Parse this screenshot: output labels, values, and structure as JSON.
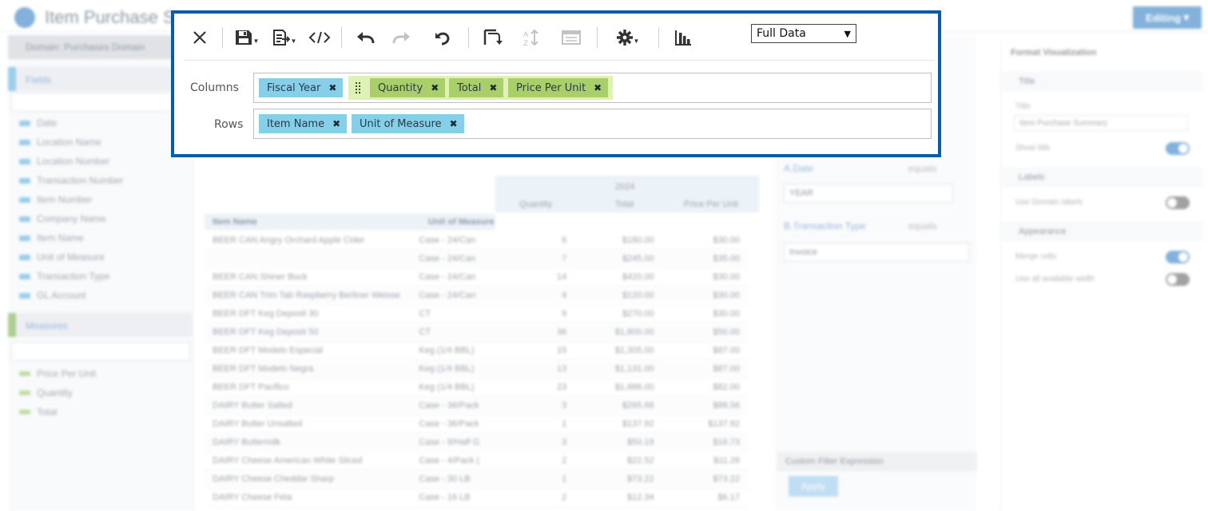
{
  "app": {
    "title": "Item Purchase Su",
    "edit_button": "Editing"
  },
  "left_panel": {
    "domain": "Domain: Purchases Domain",
    "fields_header": "Fields",
    "fields": [
      "Date",
      "Location Name",
      "Location Number",
      "Transaction Number",
      "Item Number",
      "Company Name",
      "Item Name",
      "Unit of Measure",
      "Transaction Type",
      "GL Account"
    ],
    "measures_header": "Measures",
    "measures": [
      "Price Per Unit",
      "Quantity",
      "Total"
    ]
  },
  "grid": {
    "year": "2024",
    "measure_headers": [
      "Quantity",
      "Total",
      "Price Per Unit"
    ],
    "row_headers": [
      "Item Name",
      "Unit of Measure"
    ],
    "rows": [
      [
        "BEER CAN Angry Orchard Apple Cider",
        "Case - 24/Can",
        "6",
        "$180.00",
        "$30.00"
      ],
      [
        "",
        "Case - 24/Can",
        "7",
        "$245.00",
        "$35.00"
      ],
      [
        "BEER CAN Shiner Bock",
        "Case - 24/Can",
        "14",
        "$420.00",
        "$30.00"
      ],
      [
        "BEER CAN Trim Tab Raspberry Berliner Weisse",
        "Case - 24/Can",
        "4",
        "$120.00",
        "$30.00"
      ],
      [
        "BEER DFT Keg Deposit 30",
        "CT",
        "9",
        "$270.00",
        "$30.00"
      ],
      [
        "BEER DFT Keg Deposit 50",
        "CT",
        "36",
        "$1,800.00",
        "$50.00"
      ],
      [
        "BEER DFT Modelo Especial",
        "Keg (1/4 BBL)",
        "15",
        "$1,305.00",
        "$87.00"
      ],
      [
        "BEER DFT Modelo Negra",
        "Keg (1/4 BBL)",
        "13",
        "$1,131.00",
        "$87.00"
      ],
      [
        "BEER DFT Pacifico",
        "Keg (1/4 BBL)",
        "23",
        "$1,886.00",
        "$82.00"
      ],
      [
        "DAIRY Butter Salted",
        "Case - 36/Pack",
        "3",
        "$265.68",
        "$88.56"
      ],
      [
        "DAIRY Butter Unsalted",
        "Case - 36/Pack",
        "1",
        "$137.92",
        "$137.92"
      ],
      [
        "DAIRY Buttermilk",
        "Case - 9/Half G",
        "3",
        "$50.19",
        "$16.73"
      ],
      [
        "DAIRY Cheese American White Sliced",
        "Case - 4/Pack (",
        "2",
        "$22.52",
        "$11.26"
      ],
      [
        "DAIRY Cheese Cheddar Sharp",
        "Case - 30 LB",
        "1",
        "$73.22",
        "$73.22"
      ],
      [
        "DAIRY Cheese Feta",
        "Case - 16 LB",
        "2",
        "$12.34",
        "$6.17"
      ]
    ]
  },
  "filters": {
    "filter_a": "A.Date",
    "filter_a_op": "equals",
    "filter_a_value": "YEAR",
    "filter_b": "B.Transaction Type",
    "filter_b_op": "equals",
    "filter_b_value": "Invoice",
    "custom_expression": "Custom Filter Expression",
    "apply": "Apply"
  },
  "format_panel": {
    "title": "Format Visualization",
    "title_section": "Title",
    "title_label": "Title",
    "title_value": "Item Purchase Summary",
    "show_title": "Show title",
    "labels_section": "Labels",
    "domain_labels": "Use Domain labels",
    "appearance_section": "Appearance",
    "merge_cells": "Merge cells",
    "available_width": "Use all available width"
  },
  "toolbar": {
    "view_mode": "Full Data",
    "view_options": [
      "Full Data"
    ]
  },
  "columns_shelf": {
    "label": "Columns",
    "fields": [
      "Fiscal Year"
    ],
    "measures": [
      "Quantity",
      "Total",
      "Price Per Unit"
    ]
  },
  "rows_shelf": {
    "label": "Rows",
    "fields": [
      "Item Name",
      "Unit of Measure"
    ]
  },
  "colors": {
    "focus_border": "#0b5ca8",
    "field_chip": "#86cfe8",
    "measure_chip": "#a9cf6a",
    "measure_group": "#dff1b6"
  }
}
